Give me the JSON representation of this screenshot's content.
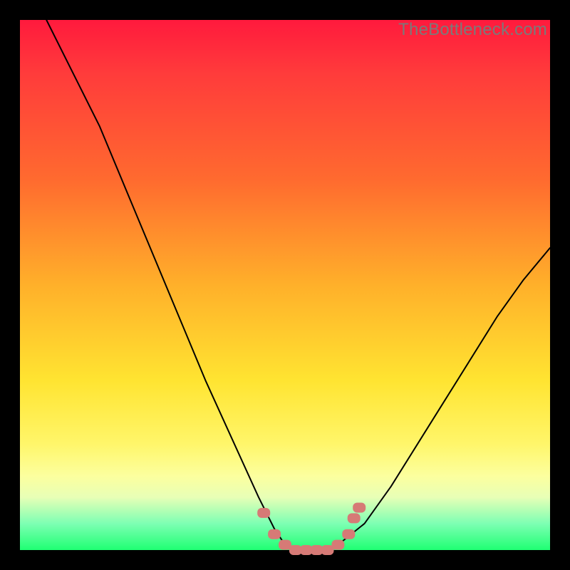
{
  "watermark": "TheBottleneck.com",
  "chart_data": {
    "type": "line",
    "title": "",
    "xlabel": "",
    "ylabel": "",
    "xlim": [
      0,
      100
    ],
    "ylim": [
      0,
      100
    ],
    "grid": false,
    "legend": false,
    "series": [
      {
        "name": "bottleneck-curve",
        "x": [
          5,
          10,
          15,
          20,
          25,
          30,
          35,
          40,
          45,
          48,
          50,
          52,
          55,
          58,
          60,
          65,
          70,
          75,
          80,
          85,
          90,
          95,
          100
        ],
        "y": [
          100,
          90,
          80,
          68,
          56,
          44,
          32,
          21,
          10,
          4,
          1,
          0,
          0,
          0,
          1,
          5,
          12,
          20,
          28,
          36,
          44,
          51,
          57
        ]
      }
    ],
    "markers": {
      "name": "highlight-dots",
      "x": [
        46,
        48,
        50,
        52,
        54,
        56,
        58,
        60,
        62,
        63,
        64
      ],
      "y": [
        7,
        3,
        1,
        0,
        0,
        0,
        0,
        1,
        3,
        6,
        8
      ]
    },
    "gradient_stops": [
      {
        "pos": 0,
        "color": "#ff1a3d"
      },
      {
        "pos": 50,
        "color": "#ffb02a"
      },
      {
        "pos": 80,
        "color": "#fff66a"
      },
      {
        "pos": 100,
        "color": "#1fff73"
      }
    ]
  }
}
